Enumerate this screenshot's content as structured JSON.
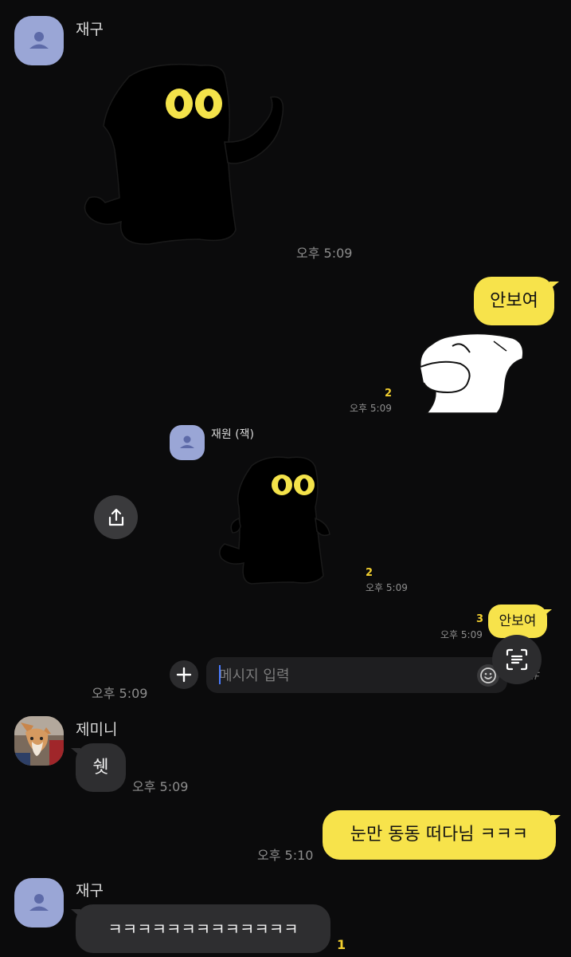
{
  "messages": {
    "m1": {
      "sender": "재구",
      "time": "오후 5:09"
    },
    "m2": {
      "text": "안보여",
      "unread": "2",
      "time": "오후 5:09"
    },
    "m3": {
      "sender": "재원 (잭)",
      "unread": "2",
      "time": "오후 5:09"
    },
    "m4": {
      "text": "안보여",
      "unread": "3",
      "time": "오후 5:09"
    },
    "m5": {
      "time": "오후 5:09"
    },
    "m6": {
      "sender": "제미니",
      "text": "쉣",
      "time": "오후 5:09"
    },
    "m7": {
      "text": "눈만 동동 떠다님 ㅋㅋㅋ",
      "time": "오후 5:10"
    },
    "m8": {
      "sender": "재구",
      "text": "ㅋㅋㅋㅋㅋㅋㅋㅋㅋㅋㅋㅋㅋ",
      "unread": "1"
    }
  },
  "composer": {
    "placeholder": "메시지 입력"
  },
  "icons": {
    "share": "share-icon",
    "plus": "plus-icon",
    "emoji": "emoji-icon",
    "scan": "text-scan-icon",
    "avatar": "person-avatar-icon"
  },
  "colors": {
    "background": "#0b0b0c",
    "my_bubble": "#f7e34b",
    "their_bubble": "#2e2e30",
    "unread": "#f2cf2f",
    "avatar": "#9aa6d6"
  }
}
